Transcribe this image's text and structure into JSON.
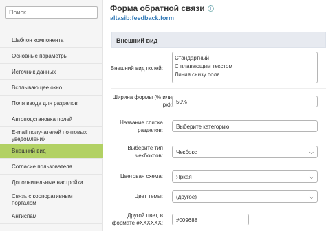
{
  "search": {
    "placeholder": "Поиск"
  },
  "sidebar": {
    "items": [
      {
        "label": "Шаблон компонента"
      },
      {
        "label": "Основные параметры"
      },
      {
        "label": "Источник данных"
      },
      {
        "label": "Всплывающее окно"
      },
      {
        "label": "Поля ввода для разделов"
      },
      {
        "label": "Автоподстановка полей"
      },
      {
        "label": "E-mail получателей почтовых уведомлений"
      },
      {
        "label": "Внешний вид"
      },
      {
        "label": "Согласие пользователя"
      },
      {
        "label": "Дополнительные настройки"
      },
      {
        "label": "Связь с корпоративным порталом"
      },
      {
        "label": "Антиспам"
      }
    ],
    "active": "Внешний вид"
  },
  "header": {
    "title": "Форма обратной связи",
    "info_icon": "i",
    "component": "altasib:feedback.form"
  },
  "section": {
    "title": "Внешний вид"
  },
  "fields": {
    "appearance": {
      "label": "Внешний вид полей:",
      "options": [
        "Стандартный",
        "С плавающим текстом",
        "Линия снизу поля"
      ]
    },
    "form_width": {
      "label": "Ширина формы (% или px):",
      "value": "50%"
    },
    "section_list_name": {
      "label": "Название списка разделов:",
      "value": "Выберите категорию"
    },
    "checkbox_type": {
      "label": "Выберите тип чекбоксов:",
      "value": "Чекбокс"
    },
    "color_scheme": {
      "label": "Цветовая схема:",
      "value": "Яркая"
    },
    "theme_color": {
      "label": "Цвет темы:",
      "value": "(другое)"
    },
    "other_color": {
      "label": "Другой цвет, в формате #XXXXXX:",
      "value": "#009688"
    }
  },
  "icons": {
    "chevron": "chevron-down-icon",
    "info": "info-icon"
  },
  "colors": {
    "active_menu": "#b2d164",
    "link": "#337ab7",
    "section_bg": "#e7eaf0"
  }
}
